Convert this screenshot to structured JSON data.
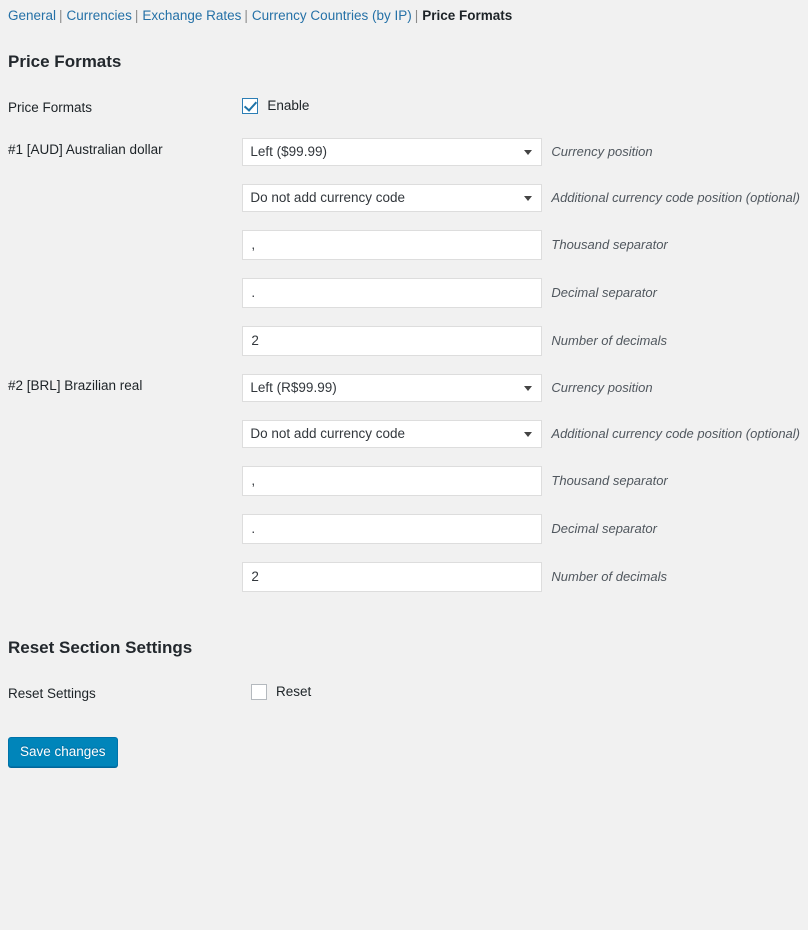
{
  "nav": {
    "links": [
      {
        "label": "General",
        "current": false
      },
      {
        "label": "Currencies",
        "current": false
      },
      {
        "label": "Exchange Rates",
        "current": false
      },
      {
        "label": "Currency Countries (by IP)",
        "current": false
      },
      {
        "label": "Price Formats",
        "current": true
      }
    ],
    "separator": "|"
  },
  "main": {
    "section_title": "Price Formats",
    "enable_row": {
      "label": "Price Formats",
      "checkbox_label": "Enable",
      "checked": true
    },
    "currencies": [
      {
        "label": "#1 [AUD] Australian dollar",
        "fields": [
          {
            "type": "select",
            "value": "Left ($99.99)",
            "desc": "Currency position"
          },
          {
            "type": "select",
            "value": "Do not add currency code",
            "desc": "Additional currency code position (optional)"
          },
          {
            "type": "text",
            "value": ",",
            "desc": "Thousand separator"
          },
          {
            "type": "text",
            "value": ".",
            "desc": "Decimal separator"
          },
          {
            "type": "text",
            "value": "2",
            "desc": "Number of decimals"
          }
        ]
      },
      {
        "label": "#2 [BRL] Brazilian real",
        "fields": [
          {
            "type": "select",
            "value": "Left (R$99.99)",
            "desc": "Currency position"
          },
          {
            "type": "select",
            "value": "Do not add currency code",
            "desc": "Additional currency code position (optional)"
          },
          {
            "type": "text",
            "value": ",",
            "desc": "Thousand separator"
          },
          {
            "type": "text",
            "value": ".",
            "desc": "Decimal separator"
          },
          {
            "type": "text",
            "value": "2",
            "desc": "Number of decimals"
          }
        ]
      }
    ]
  },
  "reset": {
    "section_title": "Reset Section Settings",
    "label": "Reset Settings",
    "checkbox_label": "Reset",
    "checked": false
  },
  "submit": {
    "save_label": "Save changes"
  },
  "colors": {
    "page_background": "#f1f1f1",
    "link": "#2571a7",
    "primary_button": "#0085ba",
    "checkbox_accent": "#1e73a8",
    "input_border": "#dddddd"
  }
}
